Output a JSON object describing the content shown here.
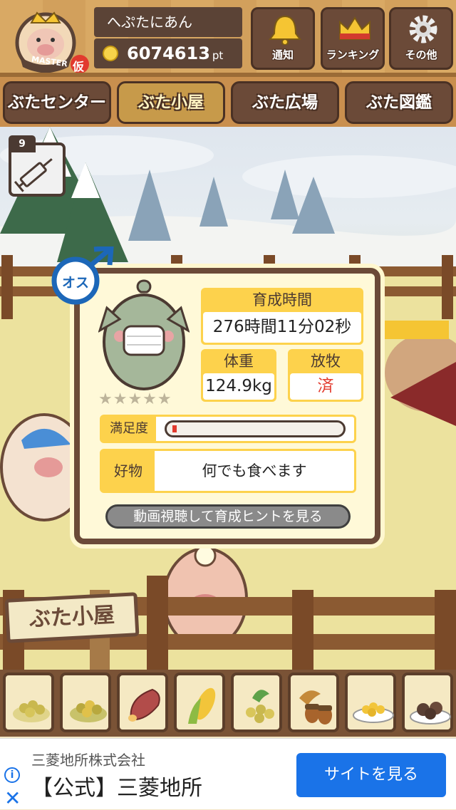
{
  "user": {
    "name": "へぷたにあん",
    "points": "6074613",
    "points_unit": "pt",
    "badge_title": "MASTER",
    "badge_mark": "仮"
  },
  "header_buttons": [
    {
      "label": "通知",
      "icon": "bell-icon"
    },
    {
      "label": "ランキング",
      "icon": "crown-icon"
    },
    {
      "label": "その他",
      "icon": "gear-icon"
    }
  ],
  "tabs": [
    {
      "label": "ぶたセンター",
      "active": false
    },
    {
      "label": "ぶた小屋",
      "active": true
    },
    {
      "label": "ぶた広場",
      "active": false
    },
    {
      "label": "ぶた図鑑",
      "active": false
    }
  ],
  "item": {
    "count": "9",
    "icon": "syringe-icon"
  },
  "pig_card": {
    "gender": "オス",
    "stars": "★★★★★",
    "raising_time_label": "育成時間",
    "raising_time": "276時間11分02秒",
    "weight_label": "体重",
    "weight": "124.9kg",
    "grazing_label": "放牧",
    "grazing": "済",
    "satisfaction_label": "満足度",
    "satisfaction": 0.02,
    "favorite_label": "好物",
    "favorite": "何でも食べます",
    "hint_button": "動画視聴して育成ヒントを見る"
  },
  "sign": {
    "text": "ぶた小屋"
  },
  "foods": [
    "soybeans-icon",
    "soybeans-icon",
    "sweet-potato-icon",
    "corn-icon",
    "turnip-icon",
    "acorn-icon",
    "corn-plate-icon",
    "meatballs-icon"
  ],
  "colors": {
    "accent_yellow": "#fdd24c",
    "wood_dark": "#6b4a38",
    "status_red": "#e23a2e",
    "ad_blue": "#1a73e8"
  },
  "ad": {
    "advertiser": "三菱地所株式会社",
    "headline": "【公式】三菱地所",
    "cta": "サイトを見る",
    "info": "i",
    "close": "✕"
  }
}
